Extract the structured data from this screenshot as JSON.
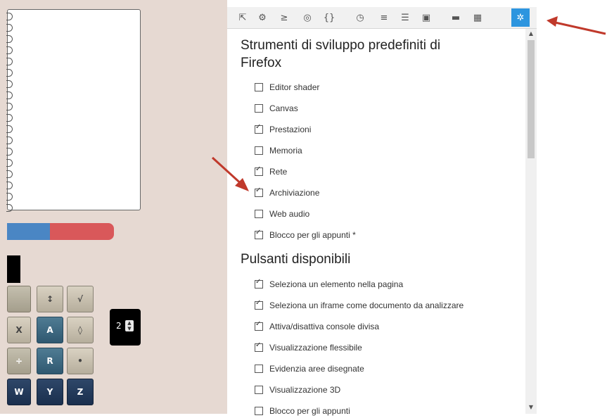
{
  "toolbar": {
    "tools": [
      {
        "icon": "inspector-icon",
        "glyph": "⇱"
      },
      {
        "icon": "debugger-icon",
        "glyph": "⚙"
      },
      {
        "icon": "console-icon",
        "glyph": "≥"
      },
      {
        "icon": "style-editor-icon",
        "glyph": "◎"
      },
      {
        "icon": "scratchpad-icon",
        "glyph": "{}"
      },
      {
        "icon": "performance-icon",
        "glyph": "◷"
      },
      {
        "icon": "network-icon",
        "glyph": "≡"
      },
      {
        "icon": "storage-icon",
        "glyph": "☰"
      },
      {
        "icon": "responsive-icon",
        "glyph": "▣"
      },
      {
        "icon": "split-console-icon",
        "glyph": "▬"
      },
      {
        "icon": "screenshot-icon",
        "glyph": "▦"
      },
      {
        "icon": "settings-icon",
        "glyph": "✲"
      }
    ]
  },
  "devtools_section": {
    "title": "Strumenti di sviluppo predefiniti di Firefox",
    "options": [
      {
        "label": "Editor shader",
        "checked": false
      },
      {
        "label": "Canvas",
        "checked": false
      },
      {
        "label": "Prestazioni",
        "checked": true
      },
      {
        "label": "Memoria",
        "checked": false
      },
      {
        "label": "Rete",
        "checked": true
      },
      {
        "label": "Archiviazione",
        "checked": true
      },
      {
        "label": "Web audio",
        "checked": false
      },
      {
        "label": "Blocco per gli appunti *",
        "checked": true
      }
    ]
  },
  "buttons_section": {
    "title": "Pulsanti disponibili",
    "options": [
      {
        "label": "Seleziona un elemento nella pagina",
        "checked": true
      },
      {
        "label": "Seleziona un iframe come documento da analizzare",
        "checked": true
      },
      {
        "label": "Attiva/disattiva console divisa",
        "checked": true
      },
      {
        "label": "Visualizzazione flessibile",
        "checked": true
      },
      {
        "label": "Evidenzia aree disegnate",
        "checked": false
      },
      {
        "label": "Visualizzazione 3D",
        "checked": false
      },
      {
        "label": "Blocco per gli appunti",
        "checked": false
      }
    ]
  },
  "left_page": {
    "progress_fraction": 0.4,
    "keypad": [
      "↕",
      "√",
      "X",
      "A",
      "◊",
      "÷",
      "R",
      "•",
      "W",
      "Y",
      "Z"
    ],
    "spinner_value": "2"
  },
  "colors": {
    "settings_active": "#2d95df",
    "annotation_arrow": "#c0392b"
  }
}
